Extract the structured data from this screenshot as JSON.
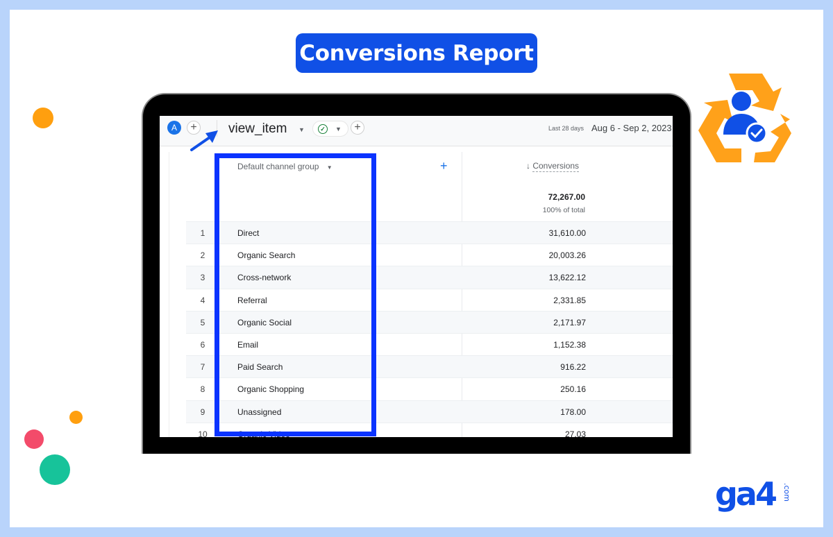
{
  "banner": {
    "title": "Conversions Report"
  },
  "report": {
    "topbar": {
      "avatar_letter": "A",
      "add_label": "+",
      "event_name": "view_item",
      "add_comparison_label": "+",
      "date_label": "Last 28 days",
      "date_range": "Aug 6 - Sep 2, 2023"
    },
    "table": {
      "dimension_header": "Default channel group",
      "add_dimension": "+",
      "metric_header": "Conversions",
      "sort_indicator": "↓",
      "total_value": "72,267.00",
      "total_pct": "100% of total",
      "rows": [
        {
          "idx": "1",
          "name": "Direct",
          "value": "31,610.00"
        },
        {
          "idx": "2",
          "name": "Organic Search",
          "value": "20,003.26"
        },
        {
          "idx": "3",
          "name": "Cross-network",
          "value": "13,622.12"
        },
        {
          "idx": "4",
          "name": "Referral",
          "value": "2,331.85"
        },
        {
          "idx": "5",
          "name": "Organic Social",
          "value": "2,171.97"
        },
        {
          "idx": "6",
          "name": "Email",
          "value": "1,152.38"
        },
        {
          "idx": "7",
          "name": "Paid Search",
          "value": "916.22"
        },
        {
          "idx": "8",
          "name": "Organic Shopping",
          "value": "250.16"
        },
        {
          "idx": "9",
          "name": "Unassigned",
          "value": "178.00"
        },
        {
          "idx": "10",
          "name": "Organic Video",
          "value": "27.03"
        }
      ]
    }
  },
  "brand": {
    "logo_text": "ga4",
    "logo_suffix": ".com"
  },
  "colors": {
    "accent_blue": "#1050e6",
    "highlight_blue": "#0a33ff",
    "orange": "#ff9f0f",
    "frame": "#b9d4fb"
  }
}
